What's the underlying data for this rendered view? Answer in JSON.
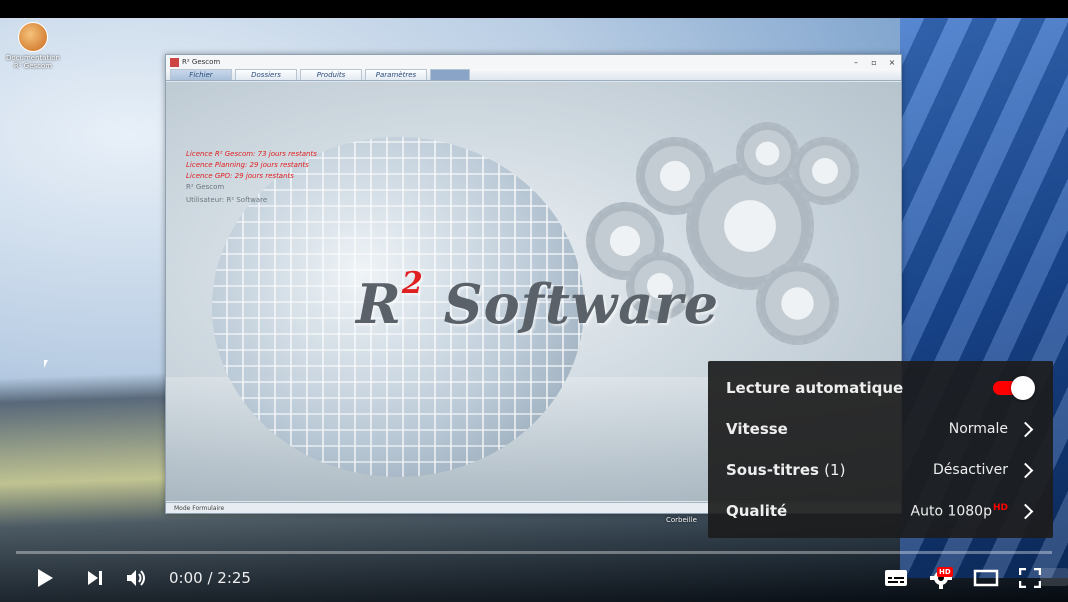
{
  "desktop": {
    "icon_label": "Documentation R² Gescom",
    "bin_label": "Corbeille"
  },
  "app": {
    "title": "R² Gescom",
    "window_buttons": {
      "minimize": "–",
      "maximize": "▫",
      "close": "×"
    },
    "menu_tabs": [
      "Fichier",
      "Dossiers",
      "Produits",
      "Paramètres"
    ],
    "license_lines": [
      "Licence R² Gescom: 73 jours restants",
      "Licence Planning: 29 jours restants",
      "Licence GPO: 29 jours restants"
    ],
    "product": "R² Gescom",
    "user": "Utilisateur: R² Software",
    "brand_r": "R",
    "brand_sup": "2",
    "brand_word": "Software",
    "status_mode": "Mode Formulaire"
  },
  "settings_menu": {
    "autoplay": {
      "label": "Lecture automatique",
      "enabled": true
    },
    "speed": {
      "label": "Vitesse",
      "value": "Normale"
    },
    "subtitles": {
      "label": "Sous-titres",
      "count": "(1)",
      "value": "Désactiver"
    },
    "quality": {
      "label": "Qualité",
      "value": "Auto 1080p",
      "badge": "HD"
    }
  },
  "player": {
    "current_time": "0:00",
    "separator": " / ",
    "duration": "2:25",
    "progress_fraction": 0.0,
    "hd_badge": "HD",
    "accent_color": "#ff0000"
  }
}
